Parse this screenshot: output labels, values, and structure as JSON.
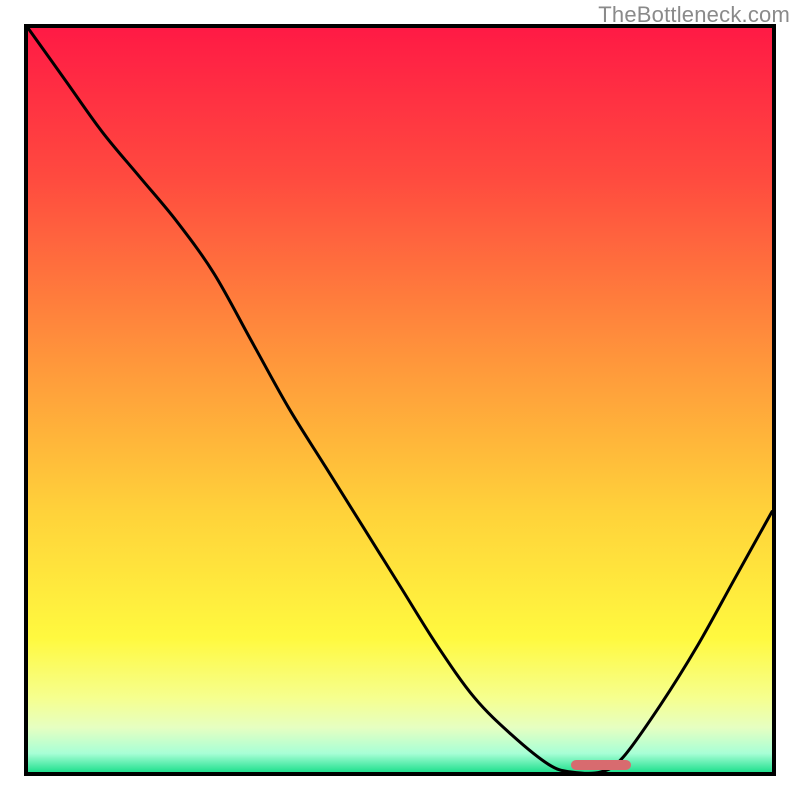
{
  "watermark": "TheBottleneck.com",
  "colors": {
    "border": "#000000",
    "curve": "#000000",
    "marker": "#d86b6f",
    "gradient_stops": [
      {
        "pos": 0.0,
        "color": "#ff1a45"
      },
      {
        "pos": 0.2,
        "color": "#ff4a3f"
      },
      {
        "pos": 0.45,
        "color": "#ff973b"
      },
      {
        "pos": 0.65,
        "color": "#ffd23a"
      },
      {
        "pos": 0.82,
        "color": "#fff93f"
      },
      {
        "pos": 0.9,
        "color": "#f6ff8e"
      },
      {
        "pos": 0.94,
        "color": "#e6ffc1"
      },
      {
        "pos": 0.975,
        "color": "#a8ffd6"
      },
      {
        "pos": 1.0,
        "color": "#21e08f"
      }
    ]
  },
  "chart_data": {
    "type": "line",
    "title": "",
    "xlabel": "",
    "ylabel": "",
    "xlim": [
      0,
      100
    ],
    "ylim": [
      0,
      100
    ],
    "x": [
      0,
      5,
      10,
      15,
      20,
      25,
      30,
      35,
      40,
      45,
      50,
      55,
      60,
      65,
      70,
      73,
      77,
      80,
      85,
      90,
      95,
      100
    ],
    "y": [
      100,
      93,
      86,
      80,
      74,
      67,
      58,
      49,
      41,
      33,
      25,
      17,
      10,
      5,
      1,
      0,
      0,
      2,
      9,
      17,
      26,
      35
    ],
    "minimum_band_x": [
      73,
      81
    ],
    "note": "y is bottleneck percent (higher = worse). Gradient background red→green top→bottom. Small rounded marker at global minimum near x≈74–80."
  }
}
